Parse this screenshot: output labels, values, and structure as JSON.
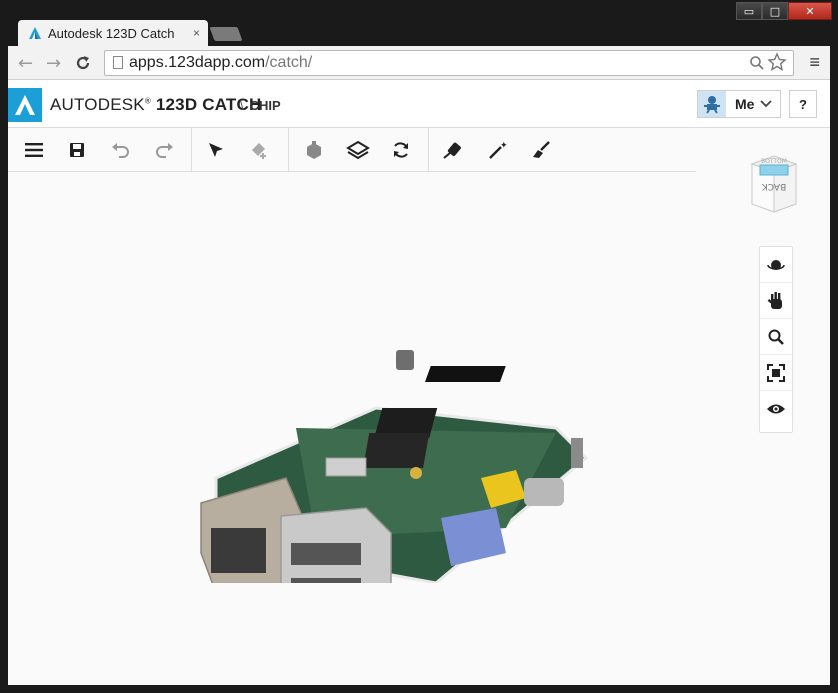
{
  "browser": {
    "tab_title": "Autodesk 123D Catch",
    "tab_close": "×",
    "url_domain": "apps.123dapp.com",
    "url_path": "/catch/",
    "back": "←",
    "forward": "→",
    "reload": "C",
    "menu": "≡",
    "window_min": "▭",
    "window_max": "□",
    "window_close": "✕"
  },
  "app": {
    "brand_prefix": "AUTODESK",
    "brand_product": "123D CATCH",
    "project_separator": "\\",
    "project_name": "CHIP",
    "user_button": "Me",
    "help_button": "?"
  },
  "toolbar_icons": [
    "menu-icon",
    "save-icon",
    "undo-icon",
    "redo-icon",
    "select-arrow-icon",
    "eraser-icon",
    "add-box-icon",
    "layers-icon",
    "rotate-icon",
    "pen-icon",
    "magic-wand-icon",
    "paint-brush-icon"
  ],
  "viewcube": {
    "top_face": "BOTTOM",
    "front_face": "BACK"
  },
  "nav_icons": [
    "orbit-icon",
    "pan-hand-icon",
    "zoom-icon",
    "fit-view-icon",
    "eye-icon"
  ],
  "colors": {
    "accent": "#1b9fd6",
    "header_bg": "#ffffff",
    "canvas_bg": "#fafafa"
  }
}
